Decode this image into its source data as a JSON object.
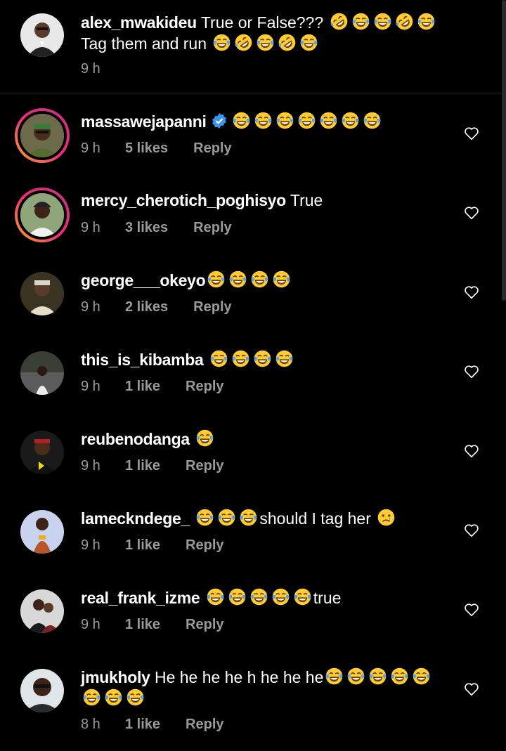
{
  "caption": {
    "username": "alex_mwakideu",
    "text": "True or False???",
    "emoji_line1": [
      "rolling-laughing-emoji",
      "joy-emoji",
      "joy-emoji",
      "rolling-laughing-emoji",
      "joy-emoji"
    ],
    "line2_text": "Tag them and run",
    "emoji_line2": [
      "joy-emoji",
      "rolling-laughing-emoji",
      "joy-emoji",
      "rolling-laughing-emoji",
      "joy-emoji"
    ],
    "time": "9 h"
  },
  "comments": [
    {
      "username": "massawejapanni",
      "verified": true,
      "text": "",
      "emojis_before": [
        "joy",
        "joy",
        "joy",
        "joy",
        "joy",
        "joy",
        "joy"
      ],
      "time": "9 h",
      "likes": "5 likes",
      "reply": "Reply",
      "story_ring": true
    },
    {
      "username": "mercy_cherotich_poghisyo",
      "text": "True",
      "time": "9 h",
      "likes": "3 likes",
      "reply": "Reply",
      "story_ring": true
    },
    {
      "username": "george___okeyo",
      "text": "",
      "time": "9 h",
      "likes": "2 likes",
      "reply": "Reply"
    },
    {
      "username": "this_is_kibamba",
      "text": "",
      "time": "9 h",
      "likes": "1 like",
      "reply": "Reply"
    },
    {
      "username": "reubenodanga",
      "text": "",
      "time": "9 h",
      "likes": "1 like",
      "reply": "Reply"
    },
    {
      "username": "lameckndege_",
      "text": "should I tag her",
      "time": "9 h",
      "likes": "1 like",
      "reply": "Reply"
    },
    {
      "username": "real_frank_izme",
      "text": "true",
      "time": "9 h",
      "likes": "1 like",
      "reply": "Reply"
    },
    {
      "username": "jmukholy",
      "text": "He he he he h he he he",
      "time": "8 h",
      "likes": "1 like",
      "reply": "Reply"
    }
  ],
  "colors": {
    "background": "#000000",
    "meta": "#9a9a9a",
    "verified": "#3897f0",
    "divider": "#262626"
  }
}
